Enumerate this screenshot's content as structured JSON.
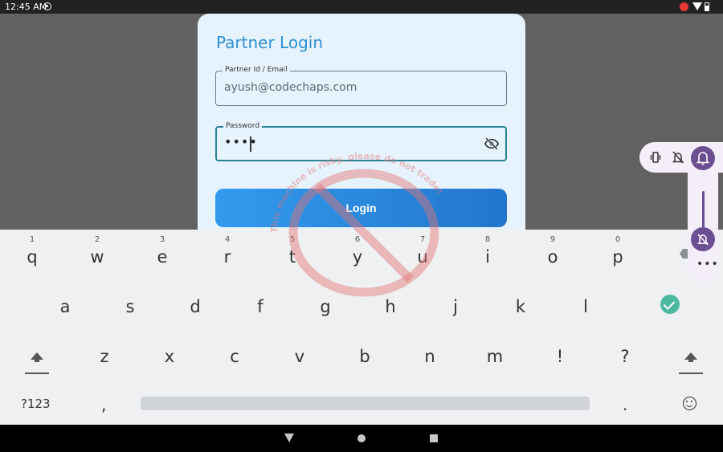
{
  "status_bar": {
    "time": "12:45 AM"
  },
  "login": {
    "title": "Partner Login",
    "id_label": "Partner Id / Email",
    "id_value": "ayush@codechaps.com",
    "password_label": "Password",
    "password_mask": "••••",
    "login_label": "Login"
  },
  "watermark": {
    "text": "This machine is risky, please do not trade!"
  },
  "keyboard": {
    "row1": [
      {
        "ch": "q",
        "num": "1"
      },
      {
        "ch": "w",
        "num": "2"
      },
      {
        "ch": "e",
        "num": "3"
      },
      {
        "ch": "r",
        "num": "4"
      },
      {
        "ch": "t",
        "num": "5"
      },
      {
        "ch": "y",
        "num": "6"
      },
      {
        "ch": "u",
        "num": "7"
      },
      {
        "ch": "i",
        "num": "8"
      },
      {
        "ch": "o",
        "num": "9"
      },
      {
        "ch": "p",
        "num": "0"
      }
    ],
    "row2": [
      "a",
      "s",
      "d",
      "f",
      "g",
      "h",
      "j",
      "k",
      "l"
    ],
    "row3": [
      "z",
      "x",
      "c",
      "v",
      "b",
      "n",
      "m",
      "!",
      "?"
    ],
    "symbols_label": "?123",
    "comma": ",",
    "period": "."
  },
  "volume_panel": {
    "more": "•••"
  },
  "colors": {
    "accent": "#2c8fd0",
    "button": "#2a86dc",
    "volume": "#6b4f91",
    "watermark": "#e57373"
  }
}
